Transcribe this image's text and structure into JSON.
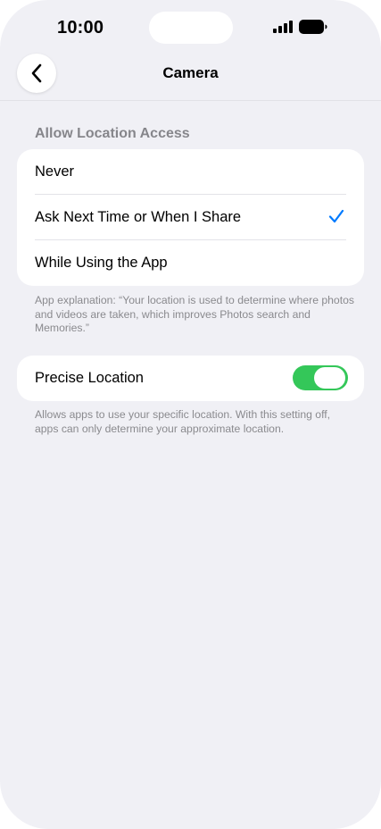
{
  "status_bar": {
    "time": "10:00"
  },
  "nav": {
    "title": "Camera"
  },
  "location_access": {
    "header": "Allow Location Access",
    "options": [
      {
        "label": "Never",
        "selected": false
      },
      {
        "label": "Ask Next Time or When I Share",
        "selected": true
      },
      {
        "label": "While Using the App",
        "selected": false
      }
    ],
    "explanation": "App explanation: “Your location is used to determine where photos and videos are taken, which improves Photos search and Memories.”"
  },
  "precise_location": {
    "label": "Precise Location",
    "enabled": true,
    "description": "Allows apps to use your specific location. With this setting off, apps can only determine your approximate location."
  },
  "colors": {
    "accent": "#007aff",
    "toggle_on": "#34c759",
    "background": "#f0f0f5"
  }
}
